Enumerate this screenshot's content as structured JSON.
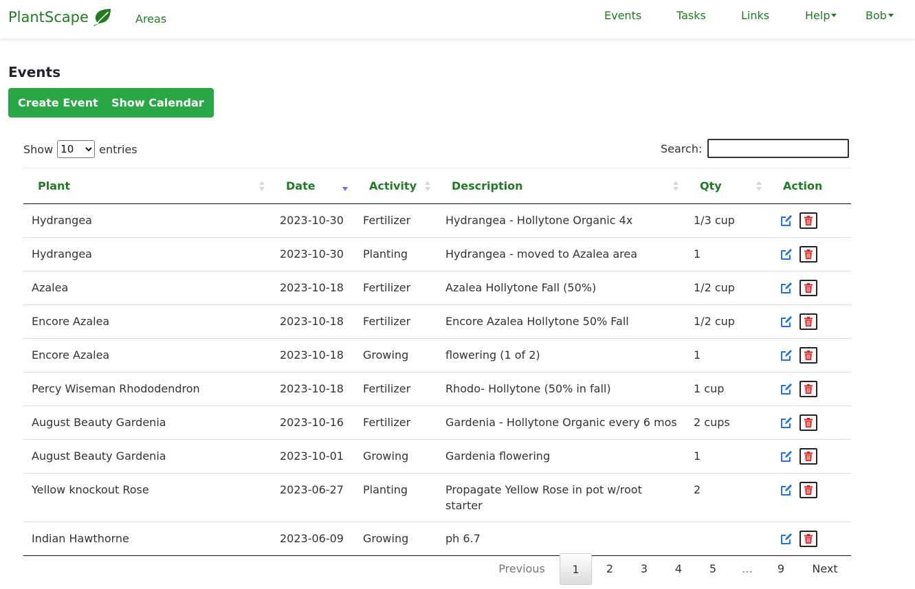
{
  "navbar": {
    "brand": "PlantScape",
    "areas": "Areas",
    "events": "Events",
    "tasks": "Tasks",
    "links": "Links",
    "help": "Help",
    "user": "Bob"
  },
  "page": {
    "title": "Events",
    "create_button": "Create Event",
    "calendar_button": "Show Calendar"
  },
  "length": {
    "show": "Show",
    "value": "10",
    "entries": "entries"
  },
  "search": {
    "label": "Search:",
    "value": ""
  },
  "table": {
    "columns": [
      "Plant",
      "Date",
      "Activity",
      "Description",
      "Qty",
      "Action"
    ],
    "sorted_column": "Date",
    "sort_direction": "descending",
    "rows": [
      {
        "plant": "Hydrangea",
        "date": "2023-10-30",
        "activity": "Fertilizer",
        "description": "Hydrangea - Hollytone Organic 4x",
        "qty": "1/3 cup"
      },
      {
        "plant": "Hydrangea",
        "date": "2023-10-30",
        "activity": "Planting",
        "description": "Hydrangea - moved to Azalea area",
        "qty": "1"
      },
      {
        "plant": "Azalea",
        "date": "2023-10-18",
        "activity": "Fertilizer",
        "description": "Azalea Hollytone Fall (50%)",
        "qty": "1/2 cup"
      },
      {
        "plant": "Encore Azalea",
        "date": "2023-10-18",
        "activity": "Fertilizer",
        "description": "Encore Azalea Hollytone 50% Fall",
        "qty": "1/2 cup"
      },
      {
        "plant": "Encore Azalea",
        "date": "2023-10-18",
        "activity": "Growing",
        "description": "flowering (1 of 2)",
        "qty": "1"
      },
      {
        "plant": "Percy Wiseman Rhododendron",
        "date": "2023-10-18",
        "activity": "Fertilizer",
        "description": "Rhodo- Hollytone (50% in fall)",
        "qty": "1 cup"
      },
      {
        "plant": "August Beauty Gardenia",
        "date": "2023-10-16",
        "activity": "Fertilizer",
        "description": "Gardenia - Hollytone Organic every 6 mos",
        "qty": "2 cups"
      },
      {
        "plant": "August Beauty Gardenia",
        "date": "2023-10-01",
        "activity": "Growing",
        "description": "Gardenia flowering",
        "qty": "1"
      },
      {
        "plant": "Yellow knockout Rose",
        "date": "2023-06-27",
        "activity": "Planting",
        "description": "Propagate Yellow Rose in pot w/root starter",
        "qty": "2"
      },
      {
        "plant": "Indian Hawthorne",
        "date": "2023-06-09",
        "activity": "Growing",
        "description": "ph 6.7",
        "qty": ""
      }
    ]
  },
  "pagination": {
    "previous": "Previous",
    "next": "Next",
    "current": "1",
    "pages": [
      "1",
      "2",
      "3",
      "4",
      "5",
      "…",
      "9"
    ]
  },
  "icons": {
    "brand": "leaf-icon",
    "edit": "edit-icon",
    "delete": "trash-icon"
  },
  "colors": {
    "brand_green": "#1e7e1e",
    "button_green": "#28a745",
    "edit_blue": "#1a73e8",
    "delete_red": "#dc1f1f",
    "sort_active": "#6b6ee8"
  }
}
